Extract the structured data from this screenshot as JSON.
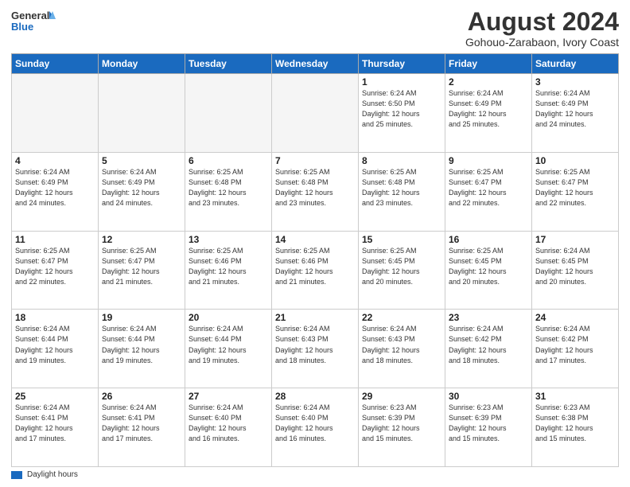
{
  "header": {
    "logo_line1": "General",
    "logo_line2": "Blue",
    "main_title": "August 2024",
    "subtitle": "Gohouo-Zarabaon, Ivory Coast"
  },
  "days_of_week": [
    "Sunday",
    "Monday",
    "Tuesday",
    "Wednesday",
    "Thursday",
    "Friday",
    "Saturday"
  ],
  "weeks": [
    [
      {
        "day": "",
        "info": ""
      },
      {
        "day": "",
        "info": ""
      },
      {
        "day": "",
        "info": ""
      },
      {
        "day": "",
        "info": ""
      },
      {
        "day": "1",
        "info": "Sunrise: 6:24 AM\nSunset: 6:50 PM\nDaylight: 12 hours\nand 25 minutes."
      },
      {
        "day": "2",
        "info": "Sunrise: 6:24 AM\nSunset: 6:49 PM\nDaylight: 12 hours\nand 25 minutes."
      },
      {
        "day": "3",
        "info": "Sunrise: 6:24 AM\nSunset: 6:49 PM\nDaylight: 12 hours\nand 24 minutes."
      }
    ],
    [
      {
        "day": "4",
        "info": "Sunrise: 6:24 AM\nSunset: 6:49 PM\nDaylight: 12 hours\nand 24 minutes."
      },
      {
        "day": "5",
        "info": "Sunrise: 6:24 AM\nSunset: 6:49 PM\nDaylight: 12 hours\nand 24 minutes."
      },
      {
        "day": "6",
        "info": "Sunrise: 6:25 AM\nSunset: 6:48 PM\nDaylight: 12 hours\nand 23 minutes."
      },
      {
        "day": "7",
        "info": "Sunrise: 6:25 AM\nSunset: 6:48 PM\nDaylight: 12 hours\nand 23 minutes."
      },
      {
        "day": "8",
        "info": "Sunrise: 6:25 AM\nSunset: 6:48 PM\nDaylight: 12 hours\nand 23 minutes."
      },
      {
        "day": "9",
        "info": "Sunrise: 6:25 AM\nSunset: 6:47 PM\nDaylight: 12 hours\nand 22 minutes."
      },
      {
        "day": "10",
        "info": "Sunrise: 6:25 AM\nSunset: 6:47 PM\nDaylight: 12 hours\nand 22 minutes."
      }
    ],
    [
      {
        "day": "11",
        "info": "Sunrise: 6:25 AM\nSunset: 6:47 PM\nDaylight: 12 hours\nand 22 minutes."
      },
      {
        "day": "12",
        "info": "Sunrise: 6:25 AM\nSunset: 6:47 PM\nDaylight: 12 hours\nand 21 minutes."
      },
      {
        "day": "13",
        "info": "Sunrise: 6:25 AM\nSunset: 6:46 PM\nDaylight: 12 hours\nand 21 minutes."
      },
      {
        "day": "14",
        "info": "Sunrise: 6:25 AM\nSunset: 6:46 PM\nDaylight: 12 hours\nand 21 minutes."
      },
      {
        "day": "15",
        "info": "Sunrise: 6:25 AM\nSunset: 6:45 PM\nDaylight: 12 hours\nand 20 minutes."
      },
      {
        "day": "16",
        "info": "Sunrise: 6:25 AM\nSunset: 6:45 PM\nDaylight: 12 hours\nand 20 minutes."
      },
      {
        "day": "17",
        "info": "Sunrise: 6:24 AM\nSunset: 6:45 PM\nDaylight: 12 hours\nand 20 minutes."
      }
    ],
    [
      {
        "day": "18",
        "info": "Sunrise: 6:24 AM\nSunset: 6:44 PM\nDaylight: 12 hours\nand 19 minutes."
      },
      {
        "day": "19",
        "info": "Sunrise: 6:24 AM\nSunset: 6:44 PM\nDaylight: 12 hours\nand 19 minutes."
      },
      {
        "day": "20",
        "info": "Sunrise: 6:24 AM\nSunset: 6:44 PM\nDaylight: 12 hours\nand 19 minutes."
      },
      {
        "day": "21",
        "info": "Sunrise: 6:24 AM\nSunset: 6:43 PM\nDaylight: 12 hours\nand 18 minutes."
      },
      {
        "day": "22",
        "info": "Sunrise: 6:24 AM\nSunset: 6:43 PM\nDaylight: 12 hours\nand 18 minutes."
      },
      {
        "day": "23",
        "info": "Sunrise: 6:24 AM\nSunset: 6:42 PM\nDaylight: 12 hours\nand 18 minutes."
      },
      {
        "day": "24",
        "info": "Sunrise: 6:24 AM\nSunset: 6:42 PM\nDaylight: 12 hours\nand 17 minutes."
      }
    ],
    [
      {
        "day": "25",
        "info": "Sunrise: 6:24 AM\nSunset: 6:41 PM\nDaylight: 12 hours\nand 17 minutes."
      },
      {
        "day": "26",
        "info": "Sunrise: 6:24 AM\nSunset: 6:41 PM\nDaylight: 12 hours\nand 17 minutes."
      },
      {
        "day": "27",
        "info": "Sunrise: 6:24 AM\nSunset: 6:40 PM\nDaylight: 12 hours\nand 16 minutes."
      },
      {
        "day": "28",
        "info": "Sunrise: 6:24 AM\nSunset: 6:40 PM\nDaylight: 12 hours\nand 16 minutes."
      },
      {
        "day": "29",
        "info": "Sunrise: 6:23 AM\nSunset: 6:39 PM\nDaylight: 12 hours\nand 15 minutes."
      },
      {
        "day": "30",
        "info": "Sunrise: 6:23 AM\nSunset: 6:39 PM\nDaylight: 12 hours\nand 15 minutes."
      },
      {
        "day": "31",
        "info": "Sunrise: 6:23 AM\nSunset: 6:38 PM\nDaylight: 12 hours\nand 15 minutes."
      }
    ]
  ],
  "legend": {
    "box_color": "#1a6abf",
    "label": "Daylight hours"
  }
}
